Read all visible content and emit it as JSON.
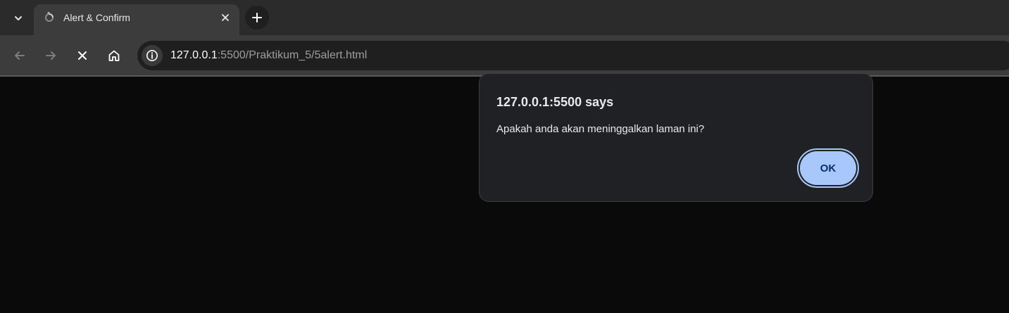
{
  "tab": {
    "title": "Alert & Confirm",
    "favicon": "webpage-spinner-icon"
  },
  "toolbar": {
    "back_icon": "back-arrow-icon",
    "forward_icon": "forward-arrow-icon",
    "stop_icon": "stop-loading-icon",
    "home_icon": "home-icon"
  },
  "omnibox": {
    "url_host": "127.0.0.1",
    "url_rest": ":5500/Praktikum_5/5alert.html",
    "info_icon": "site-info-icon"
  },
  "dialog": {
    "title": "127.0.0.1:5500 says",
    "message": "Apakah anda akan meninggalkan laman ini?",
    "ok_label": "OK"
  },
  "colors": {
    "page_background": "#0a0a0a",
    "tabstrip": "#2b2b2b",
    "toolbar": "#3c3c3c",
    "dialog_background": "#202124",
    "ok_button": "#a8c7fa",
    "ok_text": "#062e6f"
  }
}
